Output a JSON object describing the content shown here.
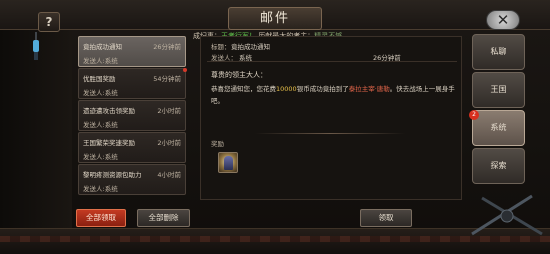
{
  "window": {
    "title": "邮件"
  },
  "header": {
    "help_label": "?",
    "close_label": "✕",
    "achievement": {
      "prefix": "成纪事：",
      "record": "王者行军！",
      "middle": " 历献最大的者主：",
      "name": "精灵不够"
    }
  },
  "mail_list": [
    {
      "title": "竟拍成功通知",
      "time": "26分钟前",
      "sender": "发送人:系统",
      "selected": true
    },
    {
      "title": "优胜国奖励",
      "time": "54分钟前",
      "sender": "发送人:系统",
      "selected": false
    },
    {
      "title": "遗迹遭攻击领奖励",
      "time": "2小时前",
      "sender": "发送人:系统",
      "selected": false
    },
    {
      "title": "王国繁荣奖速奖励",
      "time": "2小时前",
      "sender": "发送人:系统",
      "selected": false
    },
    {
      "title": "黎明疼测资源包助力",
      "time": "4小时前",
      "sender": "发送人:系统",
      "selected": false
    }
  ],
  "detail": {
    "subject_label": "标题：",
    "subject": "竟拍成功通知",
    "sender_label": "发送人：",
    "sender": "系统",
    "time": "26分钟前",
    "greeting": "尊贵的领主大人：",
    "body_part1": "恭喜您通知您，您花费",
    "body_amount": "10000",
    "body_part2": "银币成功竟拍到了",
    "body_item": "泰拉主宰·唐勒",
    "body_part3": "。快去战场上一展身手吧。",
    "attachment_label": "奖励",
    "attachment_icon": "hero-portrait-icon"
  },
  "footer": {
    "claim_all_label": "全部领取",
    "delete_all_label": "全部删除",
    "claim_label": "领取"
  },
  "tabs": [
    {
      "label": "私聊",
      "active": false
    },
    {
      "label": "王国",
      "active": false
    },
    {
      "label": "系统",
      "active": true,
      "badge": "2"
    },
    {
      "label": "探索",
      "active": false
    }
  ],
  "colors": {
    "accent_red": "#c43a22",
    "highlight_gold": "#e8c14a",
    "highlight_green": "#5fbf4b",
    "badge_red": "#d8301e"
  }
}
